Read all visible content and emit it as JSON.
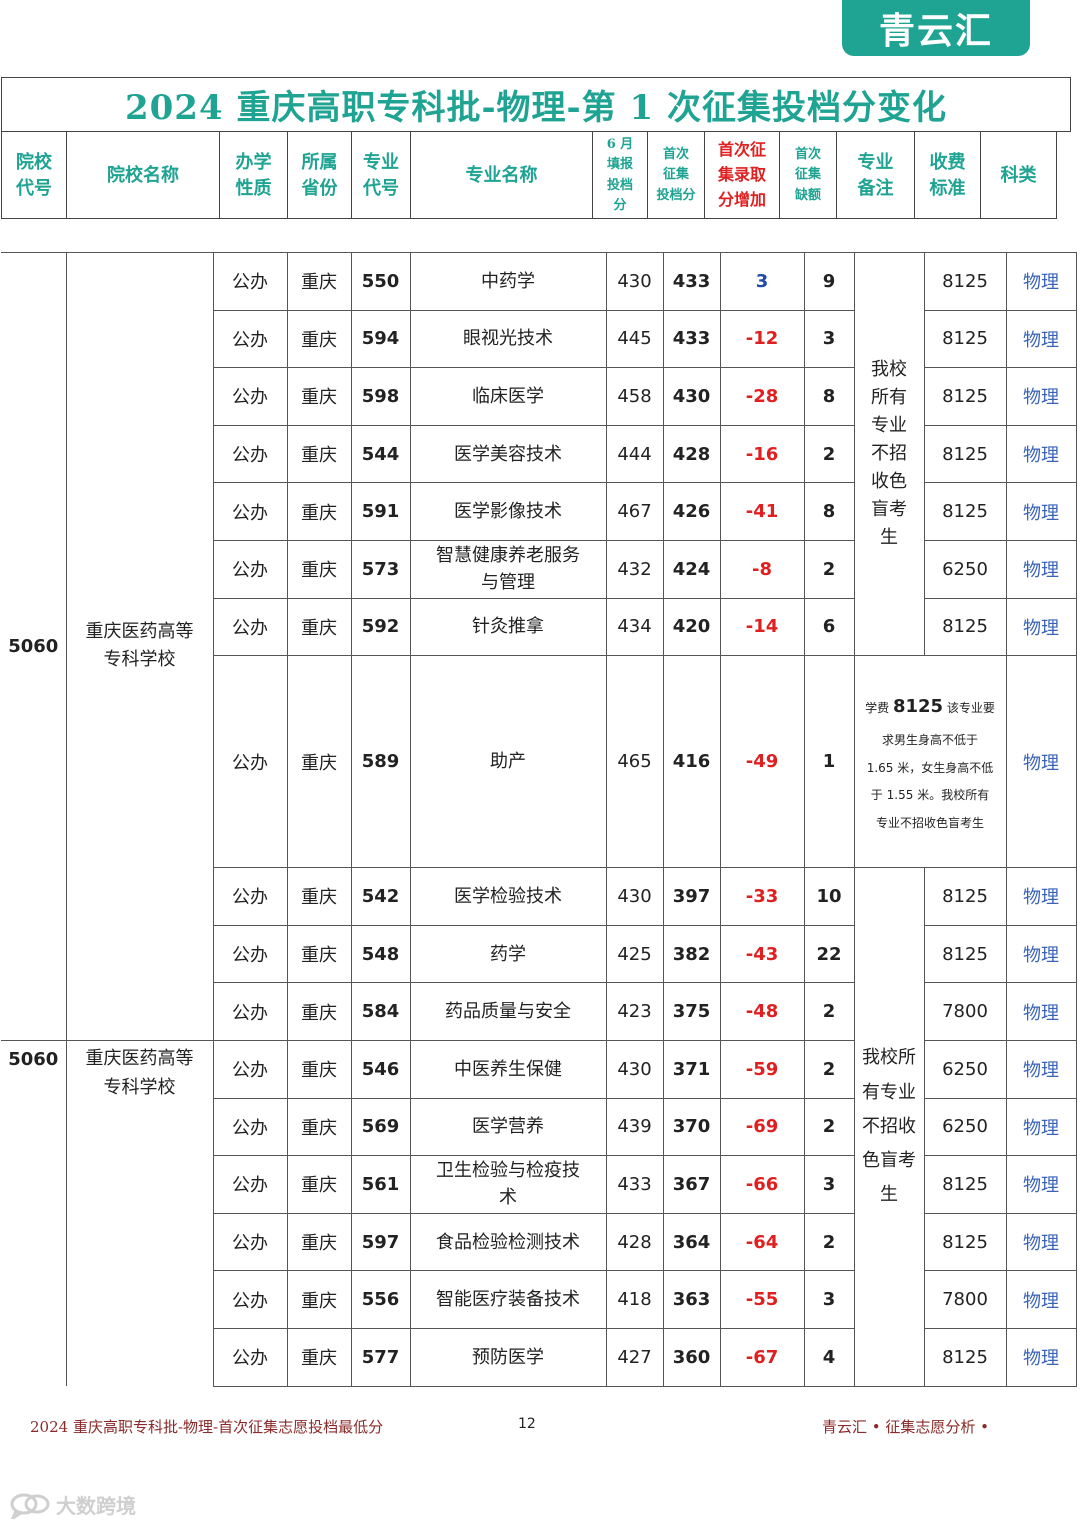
{
  "brand": {
    "name": "青云汇"
  },
  "title": "2024 重庆高职专科批-物理-第 1 次征集投档分变化",
  "headers": {
    "school_code": [
      "院校",
      "代号"
    ],
    "school_name": "院校名称",
    "nature": [
      "办学",
      "性质"
    ],
    "province": [
      "所属",
      "省份"
    ],
    "major_code": [
      "专业",
      "代号"
    ],
    "major_name": "专业名称",
    "june_score": [
      "6 月",
      "填报",
      "投档",
      "分"
    ],
    "first_score": [
      "首次",
      "征集",
      "投档分"
    ],
    "increase": [
      "首次征",
      "集录取",
      "分增加"
    ],
    "vacancy": [
      "首次",
      "征集",
      "缺额"
    ],
    "remark": [
      "专业",
      "备注"
    ],
    "fee": [
      "收费",
      "标准"
    ],
    "subject": "科类"
  },
  "schools": [
    {
      "code": "5060",
      "name": [
        "重庆医药高等",
        "专科学校"
      ]
    },
    {
      "code": "5060",
      "name": [
        "重庆医药高等",
        "专科学校"
      ]
    }
  ],
  "remarks": {
    "group1": [
      "我校",
      "所有",
      "专业",
      "不招",
      "收色",
      "盲考",
      "生"
    ],
    "group2": [
      "学费",
      "8125",
      "该专业要",
      "求男生身高不低于",
      "1.65",
      "米，女生身高不低",
      "于",
      "1.55",
      "米。我校所有",
      "专业不招收色盲考生"
    ],
    "group3": [
      "我校所",
      "有专业",
      "不招收",
      "色盲考",
      "生"
    ]
  },
  "rows": [
    {
      "nature": "公办",
      "province": "重庆",
      "code": "550",
      "major": "中药学",
      "june": "430",
      "first": "433",
      "inc": "3",
      "vac": "9",
      "fee": "8125",
      "subject": "物理"
    },
    {
      "nature": "公办",
      "province": "重庆",
      "code": "594",
      "major": "眼视光技术",
      "june": "445",
      "first": "433",
      "inc": "-12",
      "vac": "3",
      "fee": "8125",
      "subject": "物理"
    },
    {
      "nature": "公办",
      "province": "重庆",
      "code": "598",
      "major": "临床医学",
      "june": "458",
      "first": "430",
      "inc": "-28",
      "vac": "8",
      "fee": "8125",
      "subject": "物理"
    },
    {
      "nature": "公办",
      "province": "重庆",
      "code": "544",
      "major": "医学美容技术",
      "june": "444",
      "first": "428",
      "inc": "-16",
      "vac": "2",
      "fee": "8125",
      "subject": "物理"
    },
    {
      "nature": "公办",
      "province": "重庆",
      "code": "591",
      "major": "医学影像技术",
      "june": "467",
      "first": "426",
      "inc": "-41",
      "vac": "8",
      "fee": "8125",
      "subject": "物理"
    },
    {
      "nature": "公办",
      "province": "重庆",
      "code": "573",
      "major": [
        "智慧健康养老服务",
        "与管理"
      ],
      "june": "432",
      "first": "424",
      "inc": "-8",
      "vac": "2",
      "fee": "6250",
      "subject": "物理"
    },
    {
      "nature": "公办",
      "province": "重庆",
      "code": "592",
      "major": "针灸推拿",
      "june": "434",
      "first": "420",
      "inc": "-14",
      "vac": "6",
      "fee": "8125",
      "subject": "物理"
    },
    {
      "nature": "公办",
      "province": "重庆",
      "code": "589",
      "major": "助产",
      "june": "465",
      "first": "416",
      "inc": "-49",
      "vac": "1",
      "subject": "物理"
    },
    {
      "nature": "公办",
      "province": "重庆",
      "code": "542",
      "major": "医学检验技术",
      "june": "430",
      "first": "397",
      "inc": "-33",
      "vac": "10",
      "fee": "8125",
      "subject": "物理"
    },
    {
      "nature": "公办",
      "province": "重庆",
      "code": "548",
      "major": "药学",
      "june": "425",
      "first": "382",
      "inc": "-43",
      "vac": "22",
      "fee": "8125",
      "subject": "物理"
    },
    {
      "nature": "公办",
      "province": "重庆",
      "code": "584",
      "major": "药品质量与安全",
      "june": "423",
      "first": "375",
      "inc": "-48",
      "vac": "2",
      "fee": "7800",
      "subject": "物理"
    },
    {
      "nature": "公办",
      "province": "重庆",
      "code": "546",
      "major": "中医养生保健",
      "june": "430",
      "first": "371",
      "inc": "-59",
      "vac": "2",
      "fee": "6250",
      "subject": "物理"
    },
    {
      "nature": "公办",
      "province": "重庆",
      "code": "569",
      "major": "医学营养",
      "june": "439",
      "first": "370",
      "inc": "-69",
      "vac": "2",
      "fee": "6250",
      "subject": "物理"
    },
    {
      "nature": "公办",
      "province": "重庆",
      "code": "561",
      "major": [
        "卫生检验与检疫技",
        "术"
      ],
      "june": "433",
      "first": "367",
      "inc": "-66",
      "vac": "3",
      "fee": "8125",
      "subject": "物理"
    },
    {
      "nature": "公办",
      "province": "重庆",
      "code": "597",
      "major": "食品检验检测技术",
      "june": "428",
      "first": "364",
      "inc": "-64",
      "vac": "2",
      "fee": "8125",
      "subject": "物理"
    },
    {
      "nature": "公办",
      "province": "重庆",
      "code": "556",
      "major": "智能医疗装备技术",
      "june": "418",
      "first": "363",
      "inc": "-55",
      "vac": "3",
      "fee": "7800",
      "subject": "物理"
    },
    {
      "nature": "公办",
      "province": "重庆",
      "code": "577",
      "major": "预防医学",
      "june": "427",
      "first": "360",
      "inc": "-67",
      "vac": "4",
      "fee": "8125",
      "subject": "物理"
    }
  ],
  "footer": {
    "left": "2024 重庆高职专科批-物理-首次征集志愿投档最低分",
    "page": "12",
    "right": "青云汇 • 征集志愿分析 •"
  },
  "watermark": {
    "text": "大数跨境",
    "icon": "chat-bubble-icon"
  },
  "colors": {
    "accent": "#1fa392",
    "negative": "#e02020",
    "positive": "#1f4aa8",
    "subject": "#3a63b8"
  }
}
